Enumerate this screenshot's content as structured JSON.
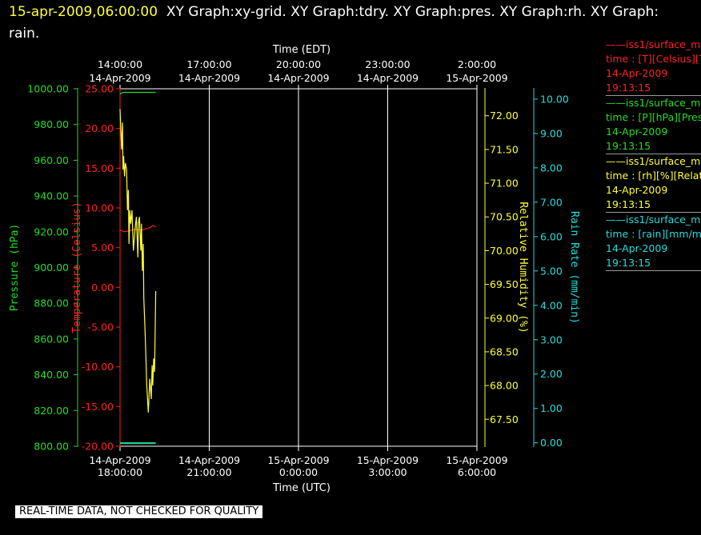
{
  "header": {
    "timestamp": "15-apr-2009,06:00:00",
    "graphs": "XY Graph:xy-grid.  XY Graph:tdry.  XY Graph:pres.  XY Graph:rh.  XY Graph: rain."
  },
  "footer_note": "REAL-TIME DATA, NOT CHECKED FOR QUALITY",
  "colors": {
    "temperature": "#ff2020",
    "pressure": "#22dd22",
    "humidity": "#ffff33",
    "rain": "#22dddd",
    "grid": "#ffffff"
  },
  "legend": [
    {
      "line1": "——iss1/surface_me",
      "line2": "time : [T][Celsius][T",
      "date": "14-Apr-2009",
      "time": "19:13:15",
      "color": "#ff2020"
    },
    {
      "line1": "——iss1/surface_me",
      "line2": "time : [P][hPa][Pres",
      "date": "14-Apr-2009",
      "time": "19:13:15",
      "color": "#22dd22"
    },
    {
      "line1": "——iss1/surface_me",
      "line2": "time : [rh][%][Relati",
      "date": "14-Apr-2009",
      "time": "19:13:15",
      "color": "#ffff33"
    },
    {
      "line1": "——iss1/surface_me",
      "line2": "time : [rain][mm/min",
      "date": "14-Apr-2009",
      "time": "19:13:15",
      "color": "#22dddd"
    }
  ],
  "chart_data": {
    "type": "line",
    "x_axis": {
      "range_hours": [
        0,
        12
      ],
      "bottom_label": "Time (UTC)",
      "bottom_ticks": [
        {
          "pos": 0,
          "l1": "14-Apr-2009",
          "l2": "18:00:00"
        },
        {
          "pos": 3,
          "l1": "14-Apr-2009",
          "l2": "21:00:00"
        },
        {
          "pos": 6,
          "l1": "15-Apr-2009",
          "l2": "0:00:00"
        },
        {
          "pos": 9,
          "l1": "15-Apr-2009",
          "l2": "3:00:00"
        },
        {
          "pos": 12,
          "l1": "15-Apr-2009",
          "l2": "6:00:00"
        }
      ],
      "top_label": "Time (EDT)",
      "top_ticks": [
        {
          "pos": 0,
          "l1": "14:00:00",
          "l2": "14-Apr-2009"
        },
        {
          "pos": 3,
          "l1": "17:00:00",
          "l2": "14-Apr-2009"
        },
        {
          "pos": 6,
          "l1": "20:00:00",
          "l2": "14-Apr-2009"
        },
        {
          "pos": 9,
          "l1": "23:00:00",
          "l2": "14-Apr-2009"
        },
        {
          "pos": 12,
          "l1": "2:00:00",
          "l2": "15-Apr-2009"
        }
      ]
    },
    "y_axes": {
      "pressure": {
        "label": "Pressure (hPa)",
        "range": [
          800,
          1000
        ],
        "ticks": [
          "800.00",
          "820.00",
          "840.00",
          "860.00",
          "880.00",
          "900.00",
          "920.00",
          "940.00",
          "960.00",
          "980.00",
          "1000.00"
        ]
      },
      "temperature": {
        "label": "Temperature (Celsius)",
        "range": [
          -20,
          25
        ],
        "ticks": [
          "-20.00",
          "-15.00",
          "-10.00",
          "-5.00",
          "0.00",
          "5.00",
          "10.00",
          "15.00",
          "20.00",
          "25.00"
        ]
      },
      "humidity": {
        "label": "Relative Humidity (%)",
        "range": [
          67.1,
          72.4
        ],
        "ticks": [
          "67.50",
          "68.00",
          "68.50",
          "69.00",
          "69.50",
          "70.00",
          "70.50",
          "71.00",
          "71.50",
          "72.00"
        ]
      },
      "rain": {
        "label": "Rain Rate (mm/min)",
        "range": [
          -0.1,
          10.3
        ],
        "ticks": [
          "0.00",
          "1.00",
          "2.00",
          "3.00",
          "4.00",
          "5.00",
          "6.00",
          "7.00",
          "8.00",
          "9.00",
          "10.00"
        ]
      }
    },
    "series": [
      {
        "key": "temperature",
        "axis": "temperature",
        "x": [
          0.0,
          0.15,
          0.3,
          0.5,
          0.7,
          0.9,
          1.0,
          1.1,
          1.2
        ],
        "y": [
          7.2,
          7.0,
          7.1,
          7.3,
          7.2,
          7.4,
          7.5,
          7.8,
          7.6
        ]
      },
      {
        "key": "pressure",
        "axis": "pressure",
        "x": [
          0.0,
          0.1,
          1.2
        ],
        "y": [
          997,
          998,
          998
        ]
      },
      {
        "key": "pressure_low",
        "axis": "pressure",
        "x": [
          0.0,
          1.2
        ],
        "y": [
          801.5,
          801.5
        ]
      },
      {
        "key": "humidity",
        "axis": "humidity",
        "x": [
          0.0,
          0.05,
          0.08,
          0.1,
          0.12,
          0.15,
          0.18,
          0.22,
          0.25,
          0.28,
          0.3,
          0.33,
          0.36,
          0.4,
          0.45,
          0.5,
          0.55,
          0.6,
          0.62,
          0.65,
          0.7,
          0.72,
          0.75,
          0.78,
          0.8,
          0.85,
          0.9,
          0.95,
          1.0,
          1.05,
          1.08,
          1.1,
          1.13,
          1.16,
          1.18,
          1.2
        ],
        "y": [
          72.1,
          71.5,
          71.9,
          71.2,
          71.4,
          71.1,
          71.3,
          71.2,
          70.6,
          70.9,
          70.1,
          70.6,
          70.4,
          70.6,
          70.0,
          70.3,
          70.5,
          69.9,
          70.4,
          70.5,
          70.0,
          70.4,
          69.7,
          70.1,
          69.3,
          68.7,
          68.0,
          67.6,
          68.1,
          67.8,
          68.3,
          68.0,
          68.4,
          68.2,
          68.8,
          69.4
        ]
      },
      {
        "key": "rain",
        "axis": "rain",
        "x": [
          0.0,
          1.2
        ],
        "y": [
          0.0,
          0.0
        ]
      }
    ]
  }
}
